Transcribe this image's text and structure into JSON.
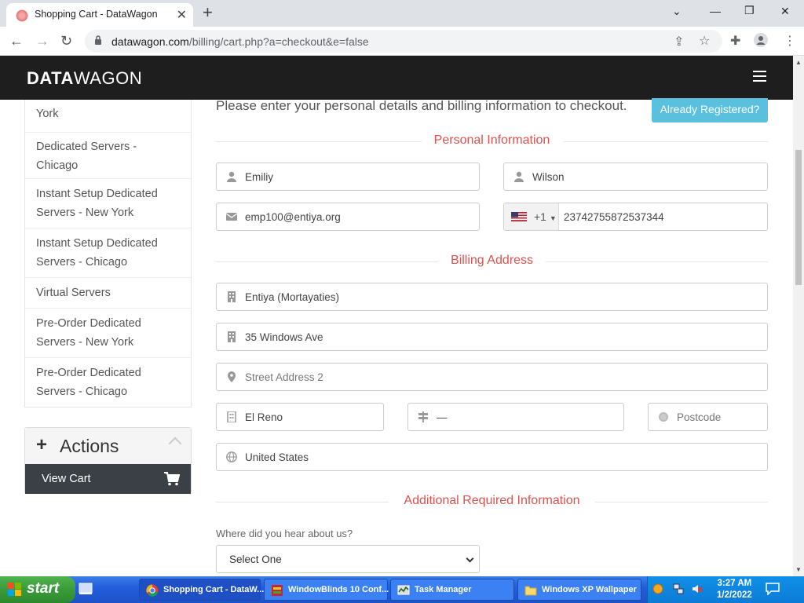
{
  "browser": {
    "tab_title": "Shopping Cart - DataWagon",
    "url_host": "datawagon.com",
    "url_path": "/billing/cart.php?a=checkout&e=false"
  },
  "site": {
    "logo_bold": "DATA",
    "logo_light": "WAGON"
  },
  "sidebar": {
    "items": [
      {
        "label": "York"
      },
      {
        "label": "Dedicated Servers -"
      },
      {
        "label": "Chicago"
      },
      {
        "label": "Instant Setup Dedicated"
      },
      {
        "label": "Servers - New York"
      },
      {
        "label": "Instant Setup Dedicated"
      },
      {
        "label": "Servers - Chicago"
      },
      {
        "label": "Virtual Servers"
      },
      {
        "label": "Pre-Order Dedicated"
      },
      {
        "label": "Servers - New York"
      },
      {
        "label": "Pre-Order Dedicated"
      },
      {
        "label": "Servers - Chicago"
      }
    ],
    "actions": {
      "title": "Actions",
      "view_cart": "View Cart"
    }
  },
  "form": {
    "intro": "Please enter your personal details and billing information to checkout.",
    "already_registered": "Already Registered?",
    "personal_title": "Personal Information",
    "first_name": "Emiliy",
    "last_name": "Wilson",
    "email": "emp100@entiya.org",
    "phone_code": "+1",
    "phone": "23742755872537344",
    "billing_title": "Billing Address",
    "company": "Entiya (Mortayaties)",
    "address1": "35 Windows Ave",
    "address2_placeholder": "Street Address 2",
    "city": "El Reno",
    "state": "—",
    "postcode_placeholder": "Postcode",
    "country": "United States",
    "additional_title": "Additional Required Information",
    "hear_label": "Where did you hear about us?",
    "hear_value": "Select One"
  },
  "taskbar": {
    "start": "start",
    "items": [
      {
        "label": "Shopping Cart - DataW..."
      },
      {
        "label": "WindowBlinds 10 Conf..."
      },
      {
        "label": "Task Manager"
      },
      {
        "label": "Windows XP Wallpaper"
      }
    ],
    "time": "3:27 AM",
    "date": "1/2/2022"
  },
  "colors": {
    "section_title": "#d9534f",
    "header_bg": "#1e1e1e",
    "button_info": "#5bc0de"
  }
}
